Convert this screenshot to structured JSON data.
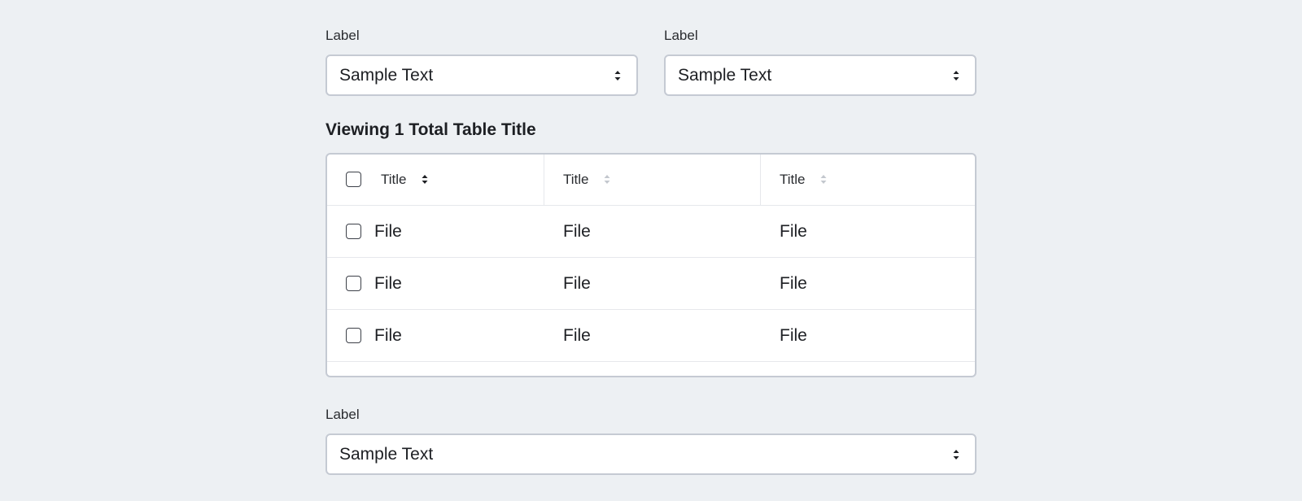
{
  "top_left_field": {
    "label": "Label",
    "value": "Sample Text"
  },
  "top_right_field": {
    "label": "Label",
    "value": "Sample Text"
  },
  "table": {
    "title": "Viewing 1 Total Table Title",
    "columns": [
      "Title",
      "Title",
      "Title"
    ],
    "rows": [
      [
        "File",
        "File",
        "File"
      ],
      [
        "File",
        "File",
        "File"
      ],
      [
        "File",
        "File",
        "File"
      ]
    ]
  },
  "bottom_field": {
    "label": "Label",
    "value": "Sample Text"
  },
  "icons": {
    "select_arrow": "chevron-up-down-icon",
    "sort_active": "sort-icon",
    "sort_inactive": "sort-icon"
  },
  "colors": {
    "background": "#edf0f3",
    "border": "#c5cad3",
    "sort_inactive": "#c3c7ce"
  }
}
